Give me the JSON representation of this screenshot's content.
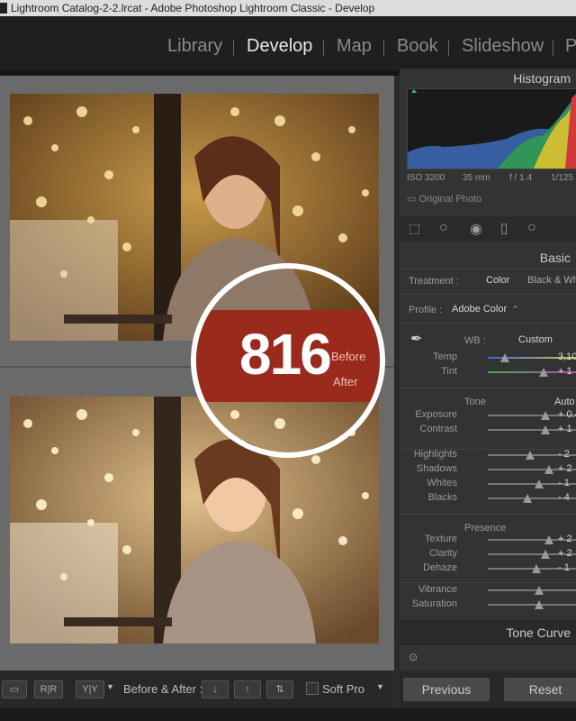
{
  "window": {
    "title": "Lightroom Catalog-2-2.lrcat - Adobe Photoshop Lightroom Classic - Develop"
  },
  "modules": [
    {
      "label": "Library"
    },
    {
      "label": "Develop"
    },
    {
      "label": "Map"
    },
    {
      "label": "Book"
    },
    {
      "label": "Slideshow"
    },
    {
      "label": "P"
    }
  ],
  "overlay": {
    "number": "816",
    "before": "Before",
    "after": "After"
  },
  "toolbar": {
    "rr_label": "R|R",
    "yy_label": "Y|Y",
    "before_after_label": "Before & After :",
    "soft_proof_label": "Soft Pro"
  },
  "panel": {
    "histogram_title": "Histogram",
    "iso": "ISO 3200",
    "focal": "35 mm",
    "aperture": "f / 1.4",
    "shutter": "1/125",
    "original_photo": "Original Photo",
    "basic_title": "Basic",
    "treatment_label": "Treatment :",
    "treatment_color": "Color",
    "treatment_bw": "Black & White",
    "profile_label": "Profile :",
    "profile_value": "Adobe Color",
    "wb_label": "WB :",
    "wb_value": "Custom",
    "tone_label": "Tone",
    "auto_label": "Auto",
    "presence_label": "Presence",
    "tone_curve_title": "Tone Curve",
    "sliders": [
      {
        "label": "Temp",
        "value": "3,10",
        "position": 0.18
      },
      {
        "label": "Tint",
        "value": "+ 1",
        "position": 0.6
      },
      {
        "label": "Exposure",
        "value": "+ 0.4",
        "position": 0.62
      },
      {
        "label": "Contrast",
        "value": "+ 1",
        "position": 0.62
      },
      {
        "label": "Highlights",
        "value": "- 2",
        "position": 0.45
      },
      {
        "label": "Shadows",
        "value": "+ 2",
        "position": 0.65
      },
      {
        "label": "Whites",
        "value": "- 1",
        "position": 0.55
      },
      {
        "label": "Blacks",
        "value": "- 4",
        "position": 0.42
      },
      {
        "label": "Texture",
        "value": "+ 2",
        "position": 0.65
      },
      {
        "label": "Clarity",
        "value": "+ 2",
        "position": 0.62
      },
      {
        "label": "Dehaze",
        "value": "- 1",
        "position": 0.52
      },
      {
        "label": "Vibrance",
        "value": "",
        "position": 0.55
      },
      {
        "label": "Saturation",
        "value": "",
        "position": 0.55
      }
    ]
  },
  "buttons": {
    "previous": "Previous",
    "reset": "Reset"
  }
}
